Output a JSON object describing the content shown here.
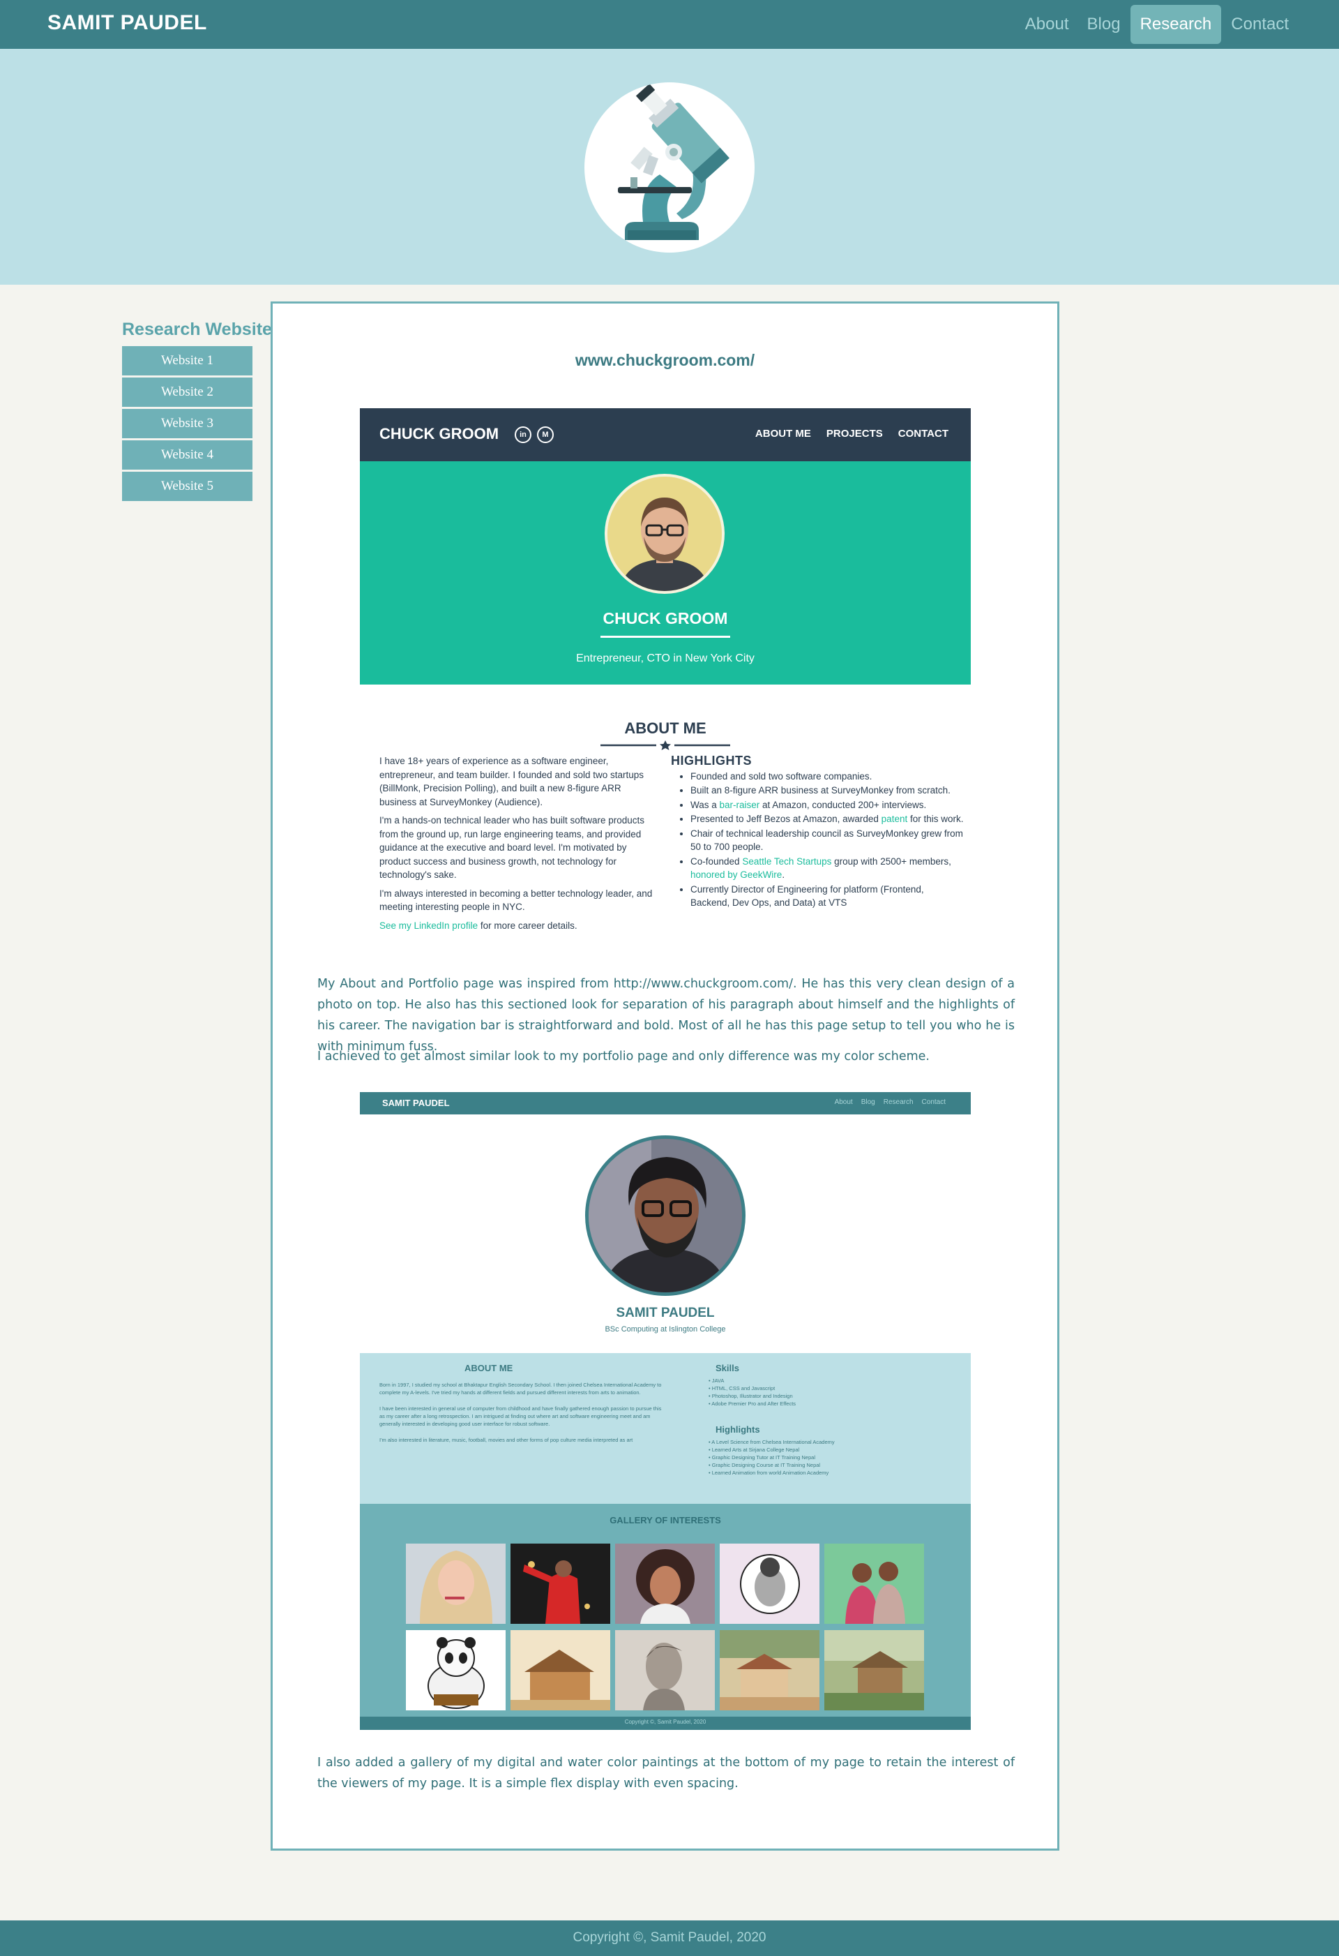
{
  "nav": {
    "brand": "SAMIT PAUDEL",
    "links": [
      "About",
      "Blog",
      "Research",
      "Contact"
    ],
    "active": "Research"
  },
  "hero": {
    "icon": "microscope-icon"
  },
  "sidebar": {
    "title": "Research Websites",
    "items": [
      "Website 1",
      "Website 2",
      "Website 3",
      "Website 4",
      "Website 5"
    ]
  },
  "main": {
    "site_url": "www.chuckgroom.com/",
    "chuck": {
      "name": "CHUCK GROOM",
      "social": [
        "in",
        "M"
      ],
      "nav": [
        "ABOUT ME",
        "PROJECTS",
        "CONTACT"
      ],
      "hero_name": "CHUCK GROOM",
      "hero_sub": "Entrepreneur, CTO in New York City",
      "about_title": "ABOUT ME",
      "paragraphs": [
        "I have 18+ years of experience as a software engineer, entrepreneur, and team builder. I founded and sold two startups (BillMonk, Precision Polling), and built a new 8-figure ARR business at SurveyMonkey (Audience).",
        "I'm a hands-on technical leader who has built software products from the ground up, run large engineering teams, and provided guidance at the executive and board level. I'm motivated by product success and business growth, not technology for technology's sake.",
        "I'm always interested in becoming a better technology leader, and meeting interesting people in NYC."
      ],
      "linkedin_link": "See my LinkedIn profile",
      "linkedin_rest": " for more career details.",
      "highlights_title": "HIGHLIGHTS",
      "highlights": [
        {
          "pre": "Founded and sold two software companies.",
          "link": "",
          "post": ""
        },
        {
          "pre": "Built an 8-figure ARR business at SurveyMonkey from scratch.",
          "link": "",
          "post": ""
        },
        {
          "pre": "Was a ",
          "link": "bar-raiser",
          "post": " at Amazon, conducted 200+ interviews."
        },
        {
          "pre": "Presented to Jeff Bezos at Amazon, awarded ",
          "link": "patent",
          "post": " for this work."
        },
        {
          "pre": "Chair of technical leadership council as SurveyMonkey grew from 50 to 700 people.",
          "link": "",
          "post": ""
        },
        {
          "pre": "Co-founded ",
          "link": "Seattle Tech Startups",
          "post": " group with 2500+ members, "
        },
        {
          "pre": "Currently Director of Engineering for platform (Frontend, Backend, Dev Ops, and Data) at VTS",
          "link": "",
          "post": ""
        }
      ],
      "highlight_extra_link": "honored by GeekWire",
      "highlight_extra_post": "."
    },
    "paragraph1": "My About and Portfolio page was inspired from http://www.chuckgroom.com/. He has this very clean design of a photo on top. He also has this sectioned look for separation of his paragraph about himself and the highlights of his career. The navigation bar is straightforward and bold. Most of all he has this page setup to tell you who he is with minimum fuss.",
    "paragraph2": "I achieved to get almost similar look to my portfolio page and only difference was my color scheme.",
    "portfolio": {
      "brand": "SAMIT PAUDEL",
      "nav": [
        "About",
        "Blog",
        "Research",
        "Contact"
      ],
      "name": "SAMIT PAUDEL",
      "subtitle": "BSc Computing at Islington College",
      "about_title": "ABOUT ME",
      "about_paragraphs": [
        "Born in 1997, I studied my school at Bhaktapur English Secondary School. I then joined Chelsea International Academy to complete my A-levels. I've tried my hands at different fields and pursued different interests from arts to animation.",
        "I have been interested in general use of computer from childhood and have finally gathered enough passion to pursue this as my career after a long retrospection. I am intrigued at finding out where art and software engineering meet and am generally interested in developing good user interface for robust software.",
        "I'm also interested in literature, music, football, movies and other forms of pop culture media interpreted as art"
      ],
      "skills_title": "Skills",
      "skills": [
        "JAVA",
        "HTML, CSS and Javascript",
        "Photoshop, Illustrator and Indesign",
        "Adobe Premier Pro and After Effects"
      ],
      "highlights_title": "Highlights",
      "highlights": [
        "A Level Science from Chelsea International Academy",
        "Learned Arts at Sirjana College Nepal",
        "Graphic Designing Tutor at IT Training Nepal",
        "Graphic Designing Course at IT Training Nepal",
        "Learned Animation from world Animation Academy"
      ],
      "gallery_title": "GALLERY OF INTERESTS",
      "gallery": [
        "portrait-woman-painting",
        "football-player-painting",
        "curly-hair-woman-painting",
        "buddha-sketch",
        "couple-painting",
        "kung-fu-panda-painting",
        "village-house-watercolor",
        "sketch-portrait-man",
        "village-watercolor",
        "hut-watercolor"
      ],
      "footer": "Copyright ©, Samit Paudel, 2020"
    },
    "paragraph3": "I also added a gallery of my digital and water color paintings at the bottom of my page to retain the interest of the viewers of my page. It is a simple flex display with even spacing."
  },
  "footer": {
    "text": "Copyright ©, Samit Paudel, 2020"
  },
  "colors": {
    "primary": "#3c8088",
    "light": "#bce0e6",
    "accent": "#6fb1b7",
    "chuck_green": "#1abc9c",
    "chuck_dark": "#2c3e50"
  }
}
